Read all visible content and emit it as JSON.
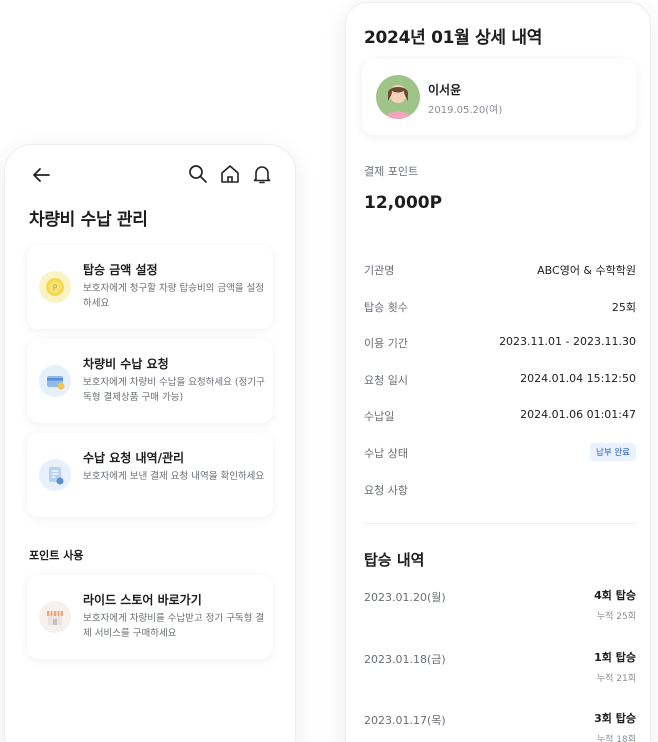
{
  "left": {
    "title": "차량비 수납 관리",
    "menu": [
      {
        "title": "탑승 금액 설정",
        "desc": "보호자에게 청구할 차량 탑승비의 금액을 설정하세요",
        "icon": "coin-icon",
        "color": "#f7e37a"
      },
      {
        "title": "차량비 수납 요청",
        "desc": "보호자에게 차량비 수납을 요청하세요 (정기구독형 결제상품 구매 가능)",
        "icon": "card-icon",
        "color": "#bcd7f5"
      },
      {
        "title": "수납 요청 내역/관리",
        "desc": "보호자에게 보낸 결제 요청 내역을 확인하세요",
        "icon": "document-icon",
        "color": "#cfe0f7"
      }
    ],
    "section": "포인트 사용",
    "store": {
      "title": "라이드 스토어 바로가기",
      "desc": "보호자에게 차량비를 수납받고 정기 구독형 결제 서비스를 구매하세요",
      "icon": "store-icon"
    }
  },
  "right": {
    "title": "2024년 01월 상세 내역",
    "profile": {
      "name": "이서윤",
      "dob": "2019.05.20(여)"
    },
    "pay_label": "결제 포인트",
    "pay_value": "12,000P",
    "details": [
      {
        "k": "기관명",
        "v": "ABC영어 & 수학학원"
      },
      {
        "k": "탑승 횟수",
        "v": "25회"
      },
      {
        "k": "이용 기간",
        "v": "2023.11.01 - 2023.11.30"
      },
      {
        "k": "요청 일시",
        "v": "2024.01.04 15:12:50"
      },
      {
        "k": "수납일",
        "v": "2024.01.06 01:01:47"
      },
      {
        "k": "수납 상태",
        "badge": "납부 완료"
      },
      {
        "k": "요청 사항",
        "v": ""
      }
    ],
    "ride_title": "탑승 내역",
    "rides": [
      {
        "date": "2023.01.20(월)",
        "count": "4회 탑승",
        "cum": "누적 25회"
      },
      {
        "date": "2023.01.18(금)",
        "count": "1회 탑승",
        "cum": "누적 21회"
      },
      {
        "date": "2023.01.17(목)",
        "count": "3회 탑승",
        "cum": "누적 18회"
      }
    ]
  }
}
